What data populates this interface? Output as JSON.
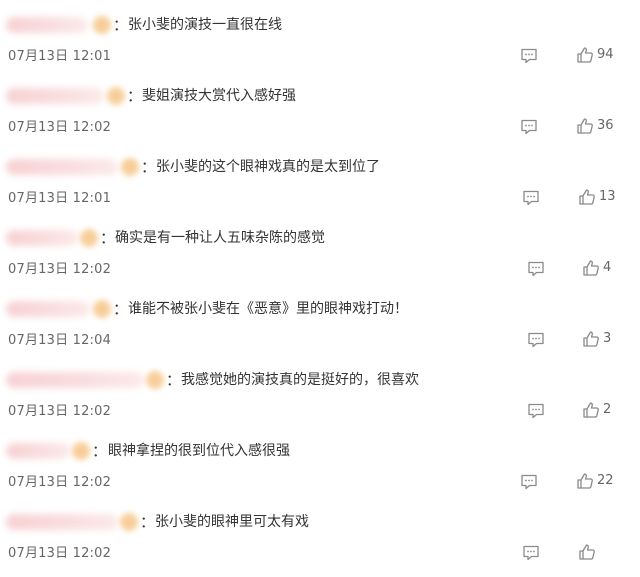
{
  "colors": {
    "text": "#333333",
    "meta": "#666666",
    "icon": "#8a8a8a",
    "blur_name": "#f6c9cc",
    "blur_badge": "#f7c98f"
  },
  "colon": "：",
  "icons": {
    "reply": "comment-bubble-icon",
    "like": "thumbs-up-icon"
  },
  "comments": [
    {
      "text": "张小斐的演技一直很在线",
      "time": "07月13日 12:01",
      "likes": "94"
    },
    {
      "text": "斐姐演技大赏代入感好强",
      "time": "07月13日 12:02",
      "likes": "36"
    },
    {
      "text": "张小斐的这个眼神戏真的是太到位了",
      "time": "07月13日 12:01",
      "likes": "13"
    },
    {
      "text": "确实是有一种让人五味杂陈的感觉",
      "time": "07月13日 12:02",
      "likes": "4"
    },
    {
      "text": "谁能不被张小斐在《恶意》里的眼神戏打动！",
      "time": "07月13日 12:04",
      "likes": "3"
    },
    {
      "text": "我感觉她的演技真的是挺好的，很喜欢",
      "time": "07月13日 12:02",
      "likes": "2"
    },
    {
      "text": "眼神拿捏的很到位代入感很强",
      "time": "07月13日 12:02",
      "likes": "22"
    },
    {
      "text": "张小斐的眼神里可太有戏",
      "time": "07月13日 12:02",
      "likes": ""
    }
  ]
}
